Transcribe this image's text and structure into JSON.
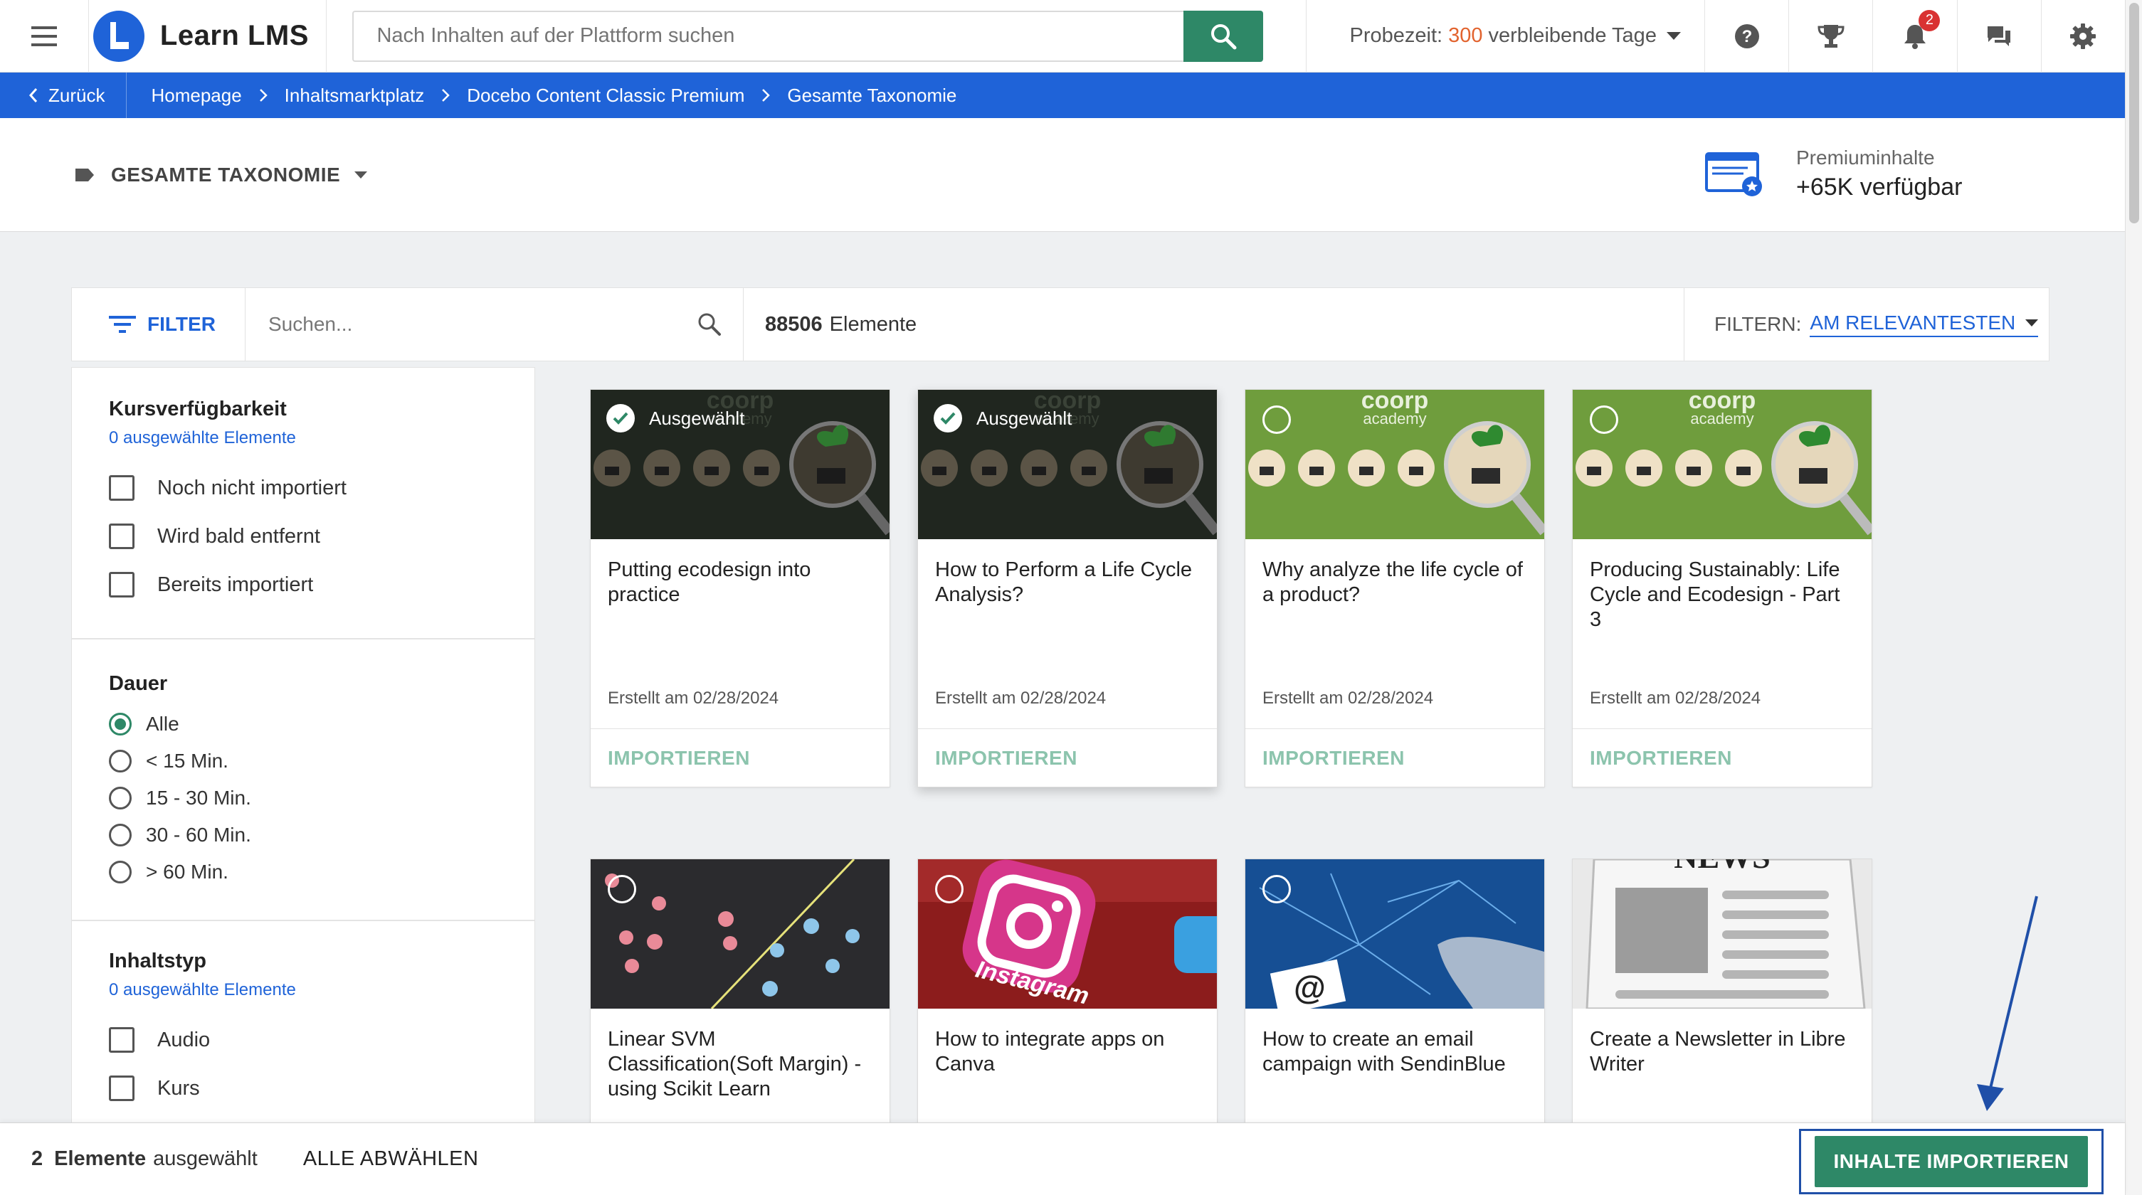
{
  "app": {
    "name": "Learn LMS"
  },
  "search": {
    "placeholder": "Nach Inhalten auf der Plattform suchen"
  },
  "trial": {
    "prefix": "Probezeit:",
    "days": "300",
    "suffix": "verbleibende Tage"
  },
  "notifications": {
    "count": "2"
  },
  "colors": {
    "brand_blue": "#1f63d8",
    "accent_green": "#2e8867",
    "trial_orange": "#e2632e",
    "badge_red": "#d93232"
  },
  "icons": [
    "menu-icon",
    "search-icon",
    "help-icon",
    "trophy-icon",
    "bell-icon",
    "chat-icon",
    "gear-icon",
    "tag-icon",
    "filter-icon",
    "chevron-left-icon",
    "chevron-right-icon",
    "check-icon",
    "premium-content-icon"
  ],
  "breadcrumb": {
    "back": "Zurück",
    "items": [
      "Homepage",
      "Inhaltsmarktplatz",
      "Docebo Content Classic Premium",
      "Gesamte Taxonomie"
    ]
  },
  "taxonomy": {
    "title": "GESAMTE TAXONOMIE"
  },
  "premium": {
    "line1": "Premiuminhalte",
    "line2": "+65K verfügbar"
  },
  "toolbar": {
    "filter_label": "FILTER",
    "search_placeholder": "Suchen...",
    "count": "88506",
    "count_label": "Elemente",
    "sort_label": "FILTERN:",
    "sort_value": "AM RELEVANTESTEN"
  },
  "filters": {
    "availability": {
      "title": "Kursverfügbarkeit",
      "selected": "0 ausgewählte Elemente",
      "options": [
        "Noch nicht importiert",
        "Wird bald entfernt",
        "Bereits importiert"
      ]
    },
    "duration": {
      "title": "Dauer",
      "options": [
        "Alle",
        "< 15 Min.",
        "15 - 30 Min.",
        "30 - 60 Min.",
        "> 60 Min."
      ],
      "selected_option": "Alle"
    },
    "content_type": {
      "title": "Inhaltstyp",
      "selected": "0 ausgewählte Elemente",
      "options": [
        "Audio",
        "Kurs"
      ]
    }
  },
  "cards": [
    {
      "title": "Putting ecodesign into practice",
      "date": "Erstellt am 02/28/2024",
      "action": "IMPORTIEREN",
      "selected": true,
      "selected_label": "Ausgewählt"
    },
    {
      "title": "How to Perform a Life Cycle Analysis?",
      "date": "Erstellt am 02/28/2024",
      "action": "IMPORTIEREN",
      "selected": true,
      "selected_label": "Ausgewählt"
    },
    {
      "title": "Why analyze the life cycle of a product?",
      "date": "Erstellt am 02/28/2024",
      "action": "IMPORTIEREN",
      "selected": false
    },
    {
      "title": "Producing Sustainably: Life Cycle and Ecodesign - Part 3",
      "date": "Erstellt am 02/28/2024",
      "action": "IMPORTIEREN",
      "selected": false
    },
    {
      "title": "Linear SVM Classification(Soft Margin) - using Scikit Learn",
      "selected": false
    },
    {
      "title": "How to integrate apps on Canva",
      "selected": false
    },
    {
      "title": "How to create an email campaign with SendinBlue",
      "selected": false
    },
    {
      "title": "Create a Newsletter in Libre Writer",
      "selected": false
    }
  ],
  "thumb_text": {
    "coorp": "coorp",
    "academy": "academy",
    "instagram": "Instagram",
    "news": "NEWS"
  },
  "bottom": {
    "count": "2",
    "count_label": "Elemente",
    "count_suffix": "ausgewählt",
    "deselect": "ALLE ABWÄHLEN",
    "import": "INHALTE IMPORTIEREN"
  }
}
